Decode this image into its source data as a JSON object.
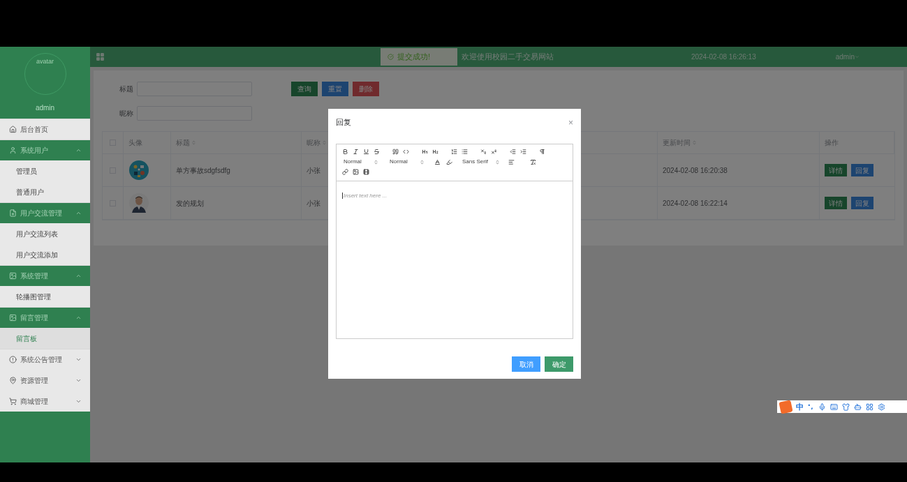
{
  "sidebar": {
    "avatar_label": "avatar",
    "username": "admin",
    "menu": [
      {
        "label": "后台首页"
      },
      {
        "label": "系统用户",
        "expanded": true,
        "children": [
          {
            "label": "管理员",
            "selected": false
          },
          {
            "label": "普通用户",
            "selected": false
          }
        ]
      },
      {
        "label": "用户交流管理",
        "expanded": true,
        "children": [
          {
            "label": "用户交流列表",
            "selected": false
          },
          {
            "label": "用户交流添加",
            "selected": false
          }
        ]
      },
      {
        "label": "系统管理",
        "expanded": true,
        "children": [
          {
            "label": "轮播图管理",
            "selected": false
          }
        ]
      },
      {
        "label": "留言管理",
        "expanded": true,
        "children": [
          {
            "label": "留言板",
            "selected": true
          }
        ]
      },
      {
        "label": "系统公告管理",
        "expanded": false
      },
      {
        "label": "资源管理",
        "expanded": false
      },
      {
        "label": "商城管理",
        "expanded": false
      }
    ]
  },
  "header": {
    "welcome": "欢迎使用校园二手交易网站",
    "datetime": "2024-02-08 16:26:13",
    "user": "admin"
  },
  "toast": {
    "text": "提交成功!"
  },
  "search": {
    "fields": [
      {
        "label": "标题"
      },
      {
        "label": "昵称"
      }
    ],
    "buttons": [
      {
        "label": "查询",
        "kind": "query"
      },
      {
        "label": "重置",
        "kind": "reset"
      },
      {
        "label": "删除",
        "kind": "delete"
      }
    ]
  },
  "table": {
    "select_all_checked": false,
    "columns": [
      {
        "label": "头像",
        "sortable": false
      },
      {
        "label": "标题",
        "sortable": true
      },
      {
        "label": "昵称",
        "sortable": true
      },
      {
        "label": "更新时间",
        "sortable": true
      },
      {
        "label": "操作",
        "sortable": false
      }
    ],
    "rows": [
      {
        "checked": false,
        "avatar": {
          "kind": "picture"
        },
        "title": "单方事故sdgfsdfg",
        "nickname": "小张",
        "updated": "2024-02-08 16:20:38",
        "actions": [
          "详情",
          "回复"
        ]
      },
      {
        "checked": false,
        "avatar": {
          "kind": "picture"
        },
        "title": "发的规划",
        "nickname": "小张",
        "updated": "2024-02-08 16:22:14",
        "actions": [
          "详情",
          "回复"
        ]
      }
    ]
  },
  "modal": {
    "title": "回复",
    "close": "×",
    "pickers": [
      "Normal",
      "Normal",
      "Sans Serif"
    ],
    "placeholder": "Insert text here ...",
    "buttons": [
      {
        "label": "取消",
        "kind": "cancel"
      },
      {
        "label": "确定",
        "kind": "confirm"
      }
    ]
  },
  "ime_bar": {
    "mode": "中"
  }
}
